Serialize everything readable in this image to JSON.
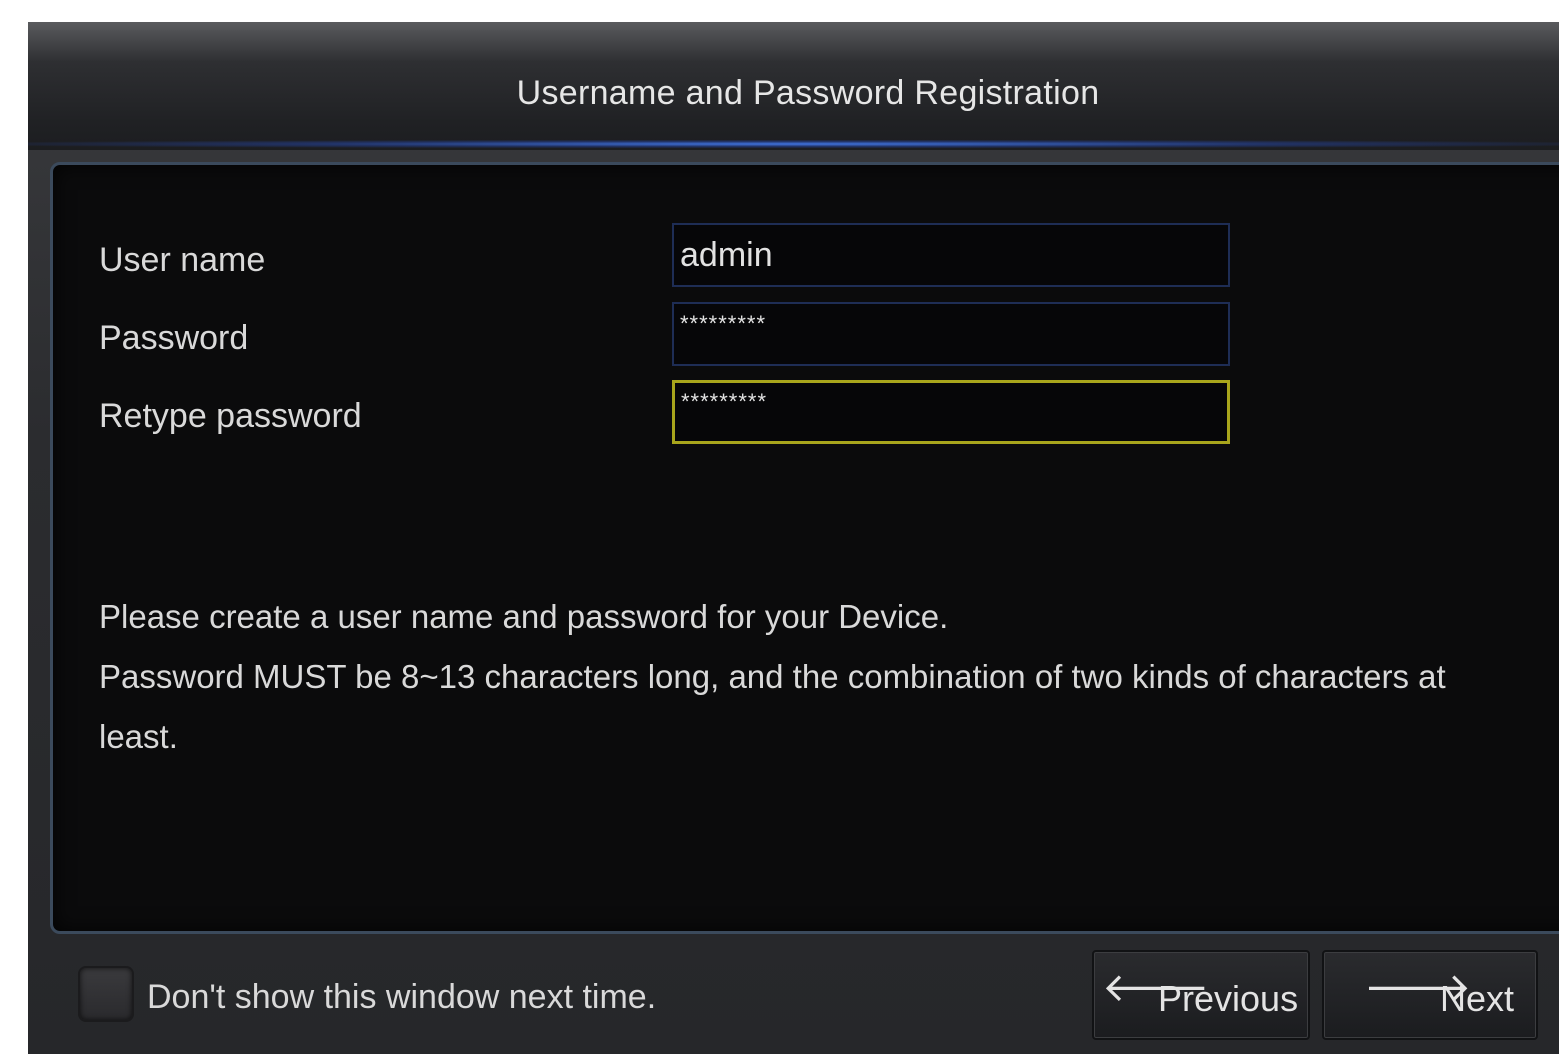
{
  "window": {
    "title": "Username and Password Registration"
  },
  "form": {
    "username_label": "User name",
    "username_value": "admin",
    "password_label": "Password",
    "password_value": "*********",
    "retype_label": "Retype password",
    "retype_value": "*********"
  },
  "info": {
    "line1": "Please create a user name and password for your Device.",
    "line2": "Password MUST be 8~13 characters long, and the combination of two kinds of characters at least."
  },
  "footer": {
    "dont_show_label": "Don't show this window next time.",
    "dont_show_checked": false,
    "previous_label": "Previous",
    "next_label": "Next"
  },
  "icons": {
    "previous": "arrow-left-icon",
    "next": "arrow-right-icon"
  },
  "colors": {
    "focused_field_border": "#a8a51c",
    "field_border": "#1e2d55",
    "title_glow": "#4682ff"
  }
}
